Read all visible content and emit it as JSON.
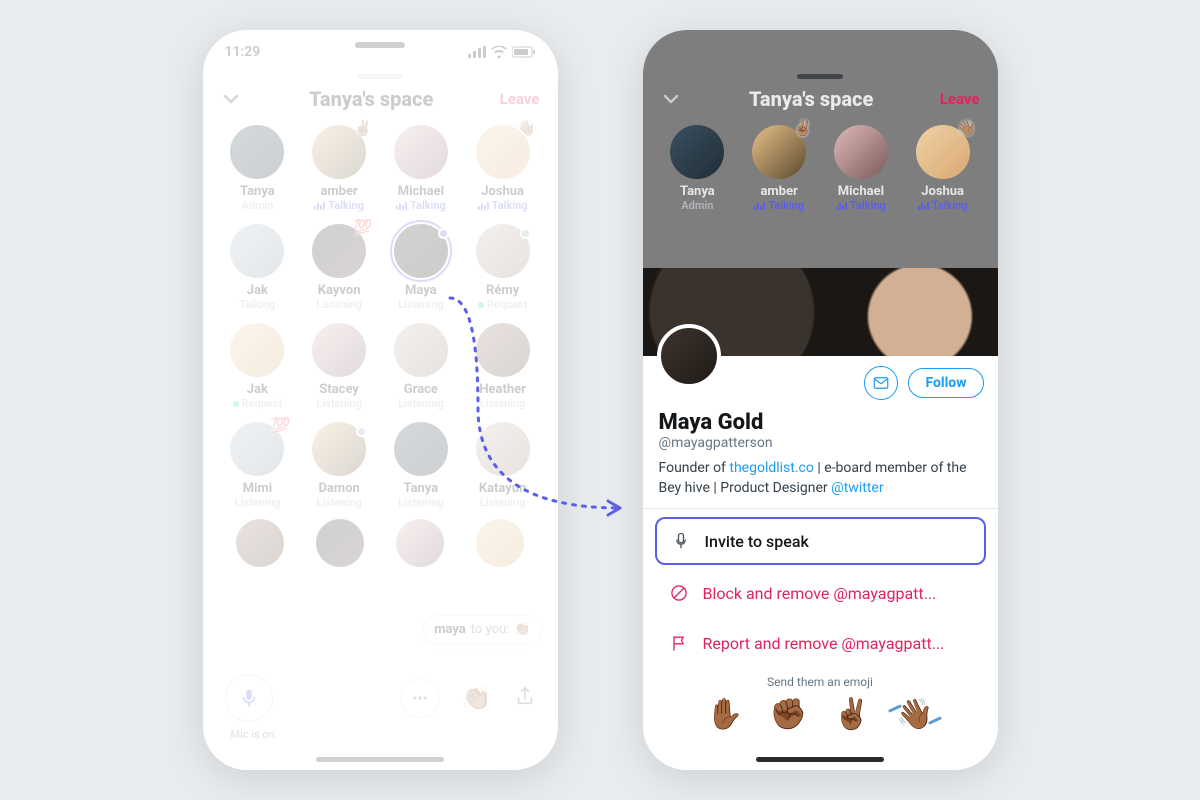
{
  "status": {
    "time": "11:29"
  },
  "space": {
    "title": "Tanya's space",
    "leave": "Leave",
    "participants_row1": [
      {
        "name": "Tanya",
        "status": "Admin",
        "kind": "admin",
        "badge": "",
        "av": "c1"
      },
      {
        "name": "amber",
        "status": "Talking",
        "kind": "talking",
        "badge": "✌🏽",
        "av": "c2"
      },
      {
        "name": "Michael",
        "status": "Talking",
        "kind": "talking",
        "badge": "",
        "av": "c3"
      },
      {
        "name": "Joshua",
        "status": "Talking",
        "kind": "talking",
        "badge": "👋🏽",
        "av": "c4"
      }
    ],
    "participants_row2": [
      {
        "name": "Jak",
        "status": "Talking",
        "kind": "plain",
        "av": "c5"
      },
      {
        "name": "Kayvon",
        "status": "Listening",
        "kind": "listen",
        "badge": "💯",
        "av": "c6"
      },
      {
        "name": "Maya",
        "status": "Listening",
        "kind": "listen",
        "dot": "blue",
        "ring": true,
        "av": "c7"
      },
      {
        "name": "Rémy",
        "status": "Request",
        "kind": "request",
        "dot": "grey",
        "av": "c8"
      }
    ],
    "participants_row3": [
      {
        "name": "Jak",
        "status": "Request",
        "kind": "request",
        "av": "c4"
      },
      {
        "name": "Stacey",
        "status": "Listening",
        "kind": "listen",
        "av": "c3"
      },
      {
        "name": "Grace",
        "status": "Listening",
        "kind": "listen",
        "av": "c8"
      },
      {
        "name": "Heather",
        "status": "Listening",
        "kind": "listen",
        "av": "c9"
      }
    ],
    "participants_row4": [
      {
        "name": "Mimi",
        "status": "Listening",
        "kind": "listen",
        "badge": "💯",
        "av": "c5"
      },
      {
        "name": "Damon",
        "status": "Listening",
        "kind": "listen",
        "dot": "grey",
        "av": "c2"
      },
      {
        "name": "Tanya",
        "status": "Listening",
        "kind": "listen",
        "av": "c1"
      },
      {
        "name": "Katayun",
        "status": "Listening",
        "kind": "listen",
        "av": "c8"
      }
    ],
    "bubble_from": "maya",
    "bubble_text": "to you:",
    "bubble_emoji": "👏🏽",
    "mic_label": "Mic is on"
  },
  "profile": {
    "name": "Maya Gold",
    "handle": "@mayagpatterson",
    "bio_pre": "Founder of ",
    "bio_link1": "thegoldlist.co",
    "bio_mid": " | e-board member of the Bey hive | Product Designer ",
    "bio_link2": "@twitter",
    "follow": "Follow",
    "invite": "Invite to speak",
    "block": "Block and remove @mayagpatt...",
    "report": "Report and remove @mayagpatt...",
    "emoji_label": "Send them an emoji",
    "emojis": [
      "✋🏾",
      "✊🏾",
      "✌🏾",
      "👋🏾"
    ]
  }
}
